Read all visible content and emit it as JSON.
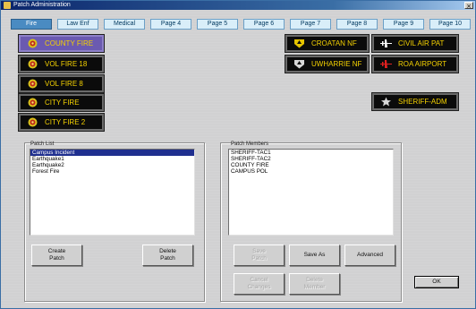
{
  "window": {
    "title": "Patch Administration",
    "close_glyph": "×"
  },
  "tabs": [
    {
      "label": "Fire",
      "active": true
    },
    {
      "label": "Law Enf",
      "active": false
    },
    {
      "label": "Medical",
      "active": false
    },
    {
      "label": "Page 4",
      "active": false
    },
    {
      "label": "Page 5",
      "active": false
    },
    {
      "label": "Page 6",
      "active": false
    },
    {
      "label": "Page 7",
      "active": false
    },
    {
      "label": "Page 8",
      "active": false
    },
    {
      "label": "Page 9",
      "active": false
    },
    {
      "label": "Page 10",
      "active": false
    }
  ],
  "patch_buttons_left": [
    {
      "label": "COUNTY FIRE",
      "icon": "fire-badge-icon",
      "selected": true
    },
    {
      "label": "VOL FIRE 18",
      "icon": "fire-badge-icon",
      "selected": false
    },
    {
      "label": "VOL FIRE 8",
      "icon": "fire-badge-icon",
      "selected": false
    },
    {
      "label": "CITY FIRE",
      "icon": "fire-badge-icon",
      "selected": false
    },
    {
      "label": "CITY FIRE 2",
      "icon": "fire-badge-icon",
      "selected": false
    }
  ],
  "patch_buttons_right": [
    {
      "label": "CROATAN NF",
      "icon": "forest-service-icon"
    },
    {
      "label": "UWHARRIE NF",
      "icon": "forest-service-icon"
    },
    {
      "label": "CIVIL AIR PAT",
      "icon": "airplane-icon"
    },
    {
      "label": "ROA AIRPORT",
      "icon": "airplane-icon"
    },
    {
      "label": "SHERIFF-ADM",
      "icon": "sheriff-star-icon"
    }
  ],
  "patch_list": {
    "label": "Patch List",
    "items": [
      {
        "text": "Campus Incident",
        "selected": true
      },
      {
        "text": "Earthquake1",
        "selected": false
      },
      {
        "text": "Earthquake2",
        "selected": false
      },
      {
        "text": "Forest Fire",
        "selected": false
      }
    ],
    "create_label": "Create\nPatch",
    "delete_label": "Delete\nPatch"
  },
  "patch_members": {
    "label": "Patch Members",
    "items": [
      "SHERIFF-TAC1",
      "SHERIFF-TAC2",
      "COUNTY FIRE",
      "CAMPUS POL"
    ],
    "save_label": "Save\nPatch",
    "save_as_label": "Save As",
    "advanced_label": "Advanced",
    "cancel_label": "Cancel\nChanges",
    "delete_member_label": "Delete\nMember"
  },
  "ok_label": "OK",
  "colors": {
    "accent": "#4a8bc2",
    "patch_text": "#f5d200",
    "patch_bg": "#0b0b0b",
    "selected_patch": "#6b5ab0",
    "list_select": "#1f2f8f"
  }
}
